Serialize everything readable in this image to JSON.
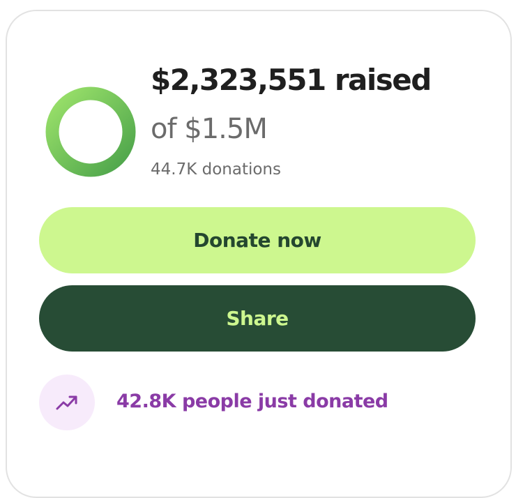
{
  "fundraiser": {
    "raised_text": "$2,323,551 raised",
    "goal_text": "of $1.5M",
    "donations_text": "44.7K donations",
    "progress_fraction": 1.0
  },
  "actions": {
    "donate_label": "Donate now",
    "share_label": "Share"
  },
  "trending": {
    "icon": "trending-up-icon",
    "text": "42.8K people just donated"
  },
  "colors": {
    "progress_light": "#9de36b",
    "progress_dark": "#4aa24a",
    "donate_bg": "#cdf78f",
    "share_bg": "#274c35",
    "trend_purple": "#8a3ba6"
  }
}
